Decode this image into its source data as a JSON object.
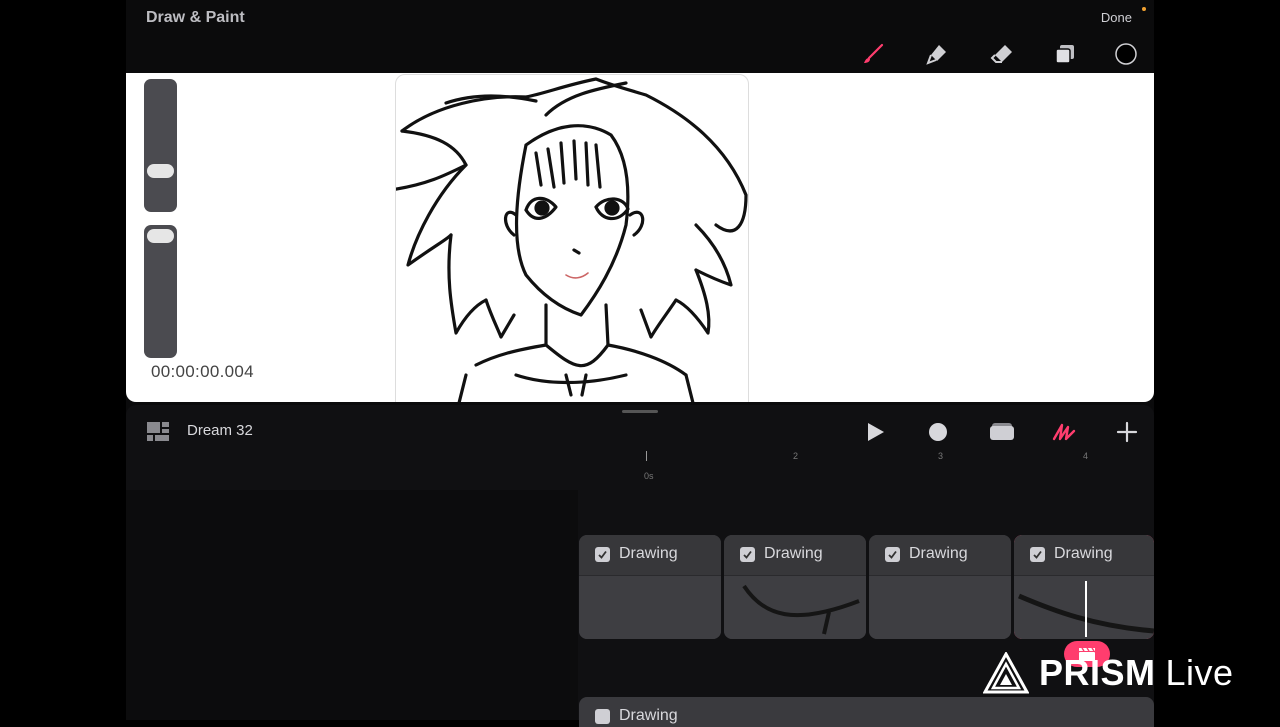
{
  "header": {
    "title": "Draw & Paint",
    "done_label": "Done"
  },
  "tools": [
    {
      "name": "brush-icon",
      "active": true
    },
    {
      "name": "smudge-icon",
      "active": false
    },
    {
      "name": "eraser-icon",
      "active": false
    },
    {
      "name": "layers-icon",
      "active": false
    },
    {
      "name": "color-icon",
      "active": false
    }
  ],
  "canvas": {
    "timecode": "00:00:00.004",
    "brush_size_level": 0.7,
    "opacity_level": 0.05
  },
  "timeline": {
    "project_name": "Dream 32",
    "ruler_current": "0s",
    "ruler_ticks": [
      "2",
      "3",
      "4"
    ],
    "clips": [
      {
        "label": "Drawing",
        "checked": true,
        "selected": false
      },
      {
        "label": "Drawing",
        "checked": true,
        "selected": false
      },
      {
        "label": "Drawing",
        "checked": true,
        "selected": false
      },
      {
        "label": "Drawing",
        "checked": true,
        "selected": true
      }
    ],
    "track2_label": "Drawing"
  },
  "watermark": {
    "brand": "PRISM",
    "suffix": "Live"
  },
  "colors": {
    "accent": "#ff3d6e",
    "background": "#0b0b0c"
  }
}
